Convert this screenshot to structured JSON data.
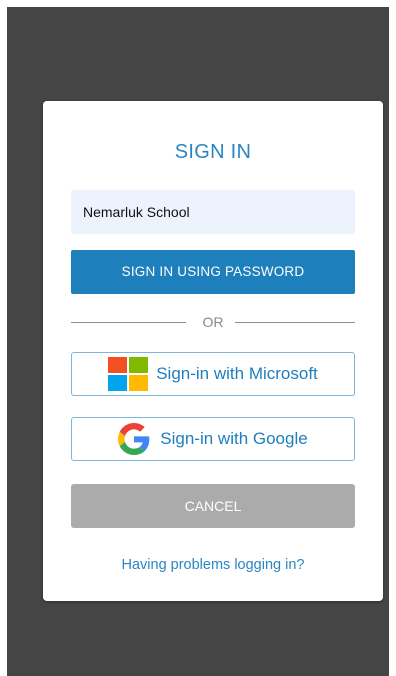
{
  "dialog": {
    "title": "SIGN IN",
    "school_name": "Nemarluk School",
    "password_button": "SIGN IN USING PASSWORD",
    "divider_text": "OR",
    "microsoft_button": "Sign-in with Microsoft",
    "google_button": "Sign-in with Google",
    "cancel_button": "CANCEL",
    "help_link": "Having problems logging in?"
  },
  "icons": {
    "microsoft": "microsoft-logo-icon",
    "google": "google-logo-icon"
  },
  "colors": {
    "accent": "#1e7fbd",
    "title": "#2a86c2",
    "field_bg": "#edf3fc",
    "cancel_bg": "#ababab",
    "backdrop": "#454545"
  }
}
